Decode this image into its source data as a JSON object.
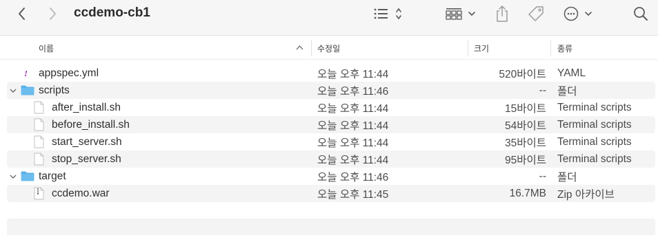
{
  "window": {
    "title": "ccdemo-cb1"
  },
  "toolbar": {
    "icons": [
      "chevron-left-icon",
      "chevron-right-icon",
      "list-view-icon",
      "group-grid-icon",
      "share-icon",
      "tag-icon",
      "more-icon",
      "search-icon"
    ]
  },
  "columns": {
    "name": "이름",
    "modified": "수정일",
    "size": "크기",
    "kind": "종류"
  },
  "files": [
    {
      "name": "appspec.yml",
      "modified": "오늘 오후 11:44",
      "size": "520바이트",
      "kind": "YAML",
      "icon": "yaml-file-icon"
    },
    {
      "name": "scripts",
      "modified": "오늘 오후 11:46",
      "size": "--",
      "kind": "폴더",
      "icon": "folder-icon",
      "expanded": true
    },
    {
      "name": "after_install.sh",
      "modified": "오늘 오후 11:44",
      "size": "15바이트",
      "kind": "Terminal scripts",
      "icon": "document-icon"
    },
    {
      "name": "before_install.sh",
      "modified": "오늘 오후 11:44",
      "size": "54바이트",
      "kind": "Terminal scripts",
      "icon": "document-icon"
    },
    {
      "name": "start_server.sh",
      "modified": "오늘 오후 11:44",
      "size": "35바이트",
      "kind": "Terminal scripts",
      "icon": "document-icon"
    },
    {
      "name": "stop_server.sh",
      "modified": "오늘 오후 11:44",
      "size": "95바이트",
      "kind": "Terminal scripts",
      "icon": "document-icon"
    },
    {
      "name": "target",
      "modified": "오늘 오후 11:46",
      "size": "--",
      "kind": "폴더",
      "icon": "folder-icon",
      "expanded": true
    },
    {
      "name": "ccdemo.war",
      "modified": "오늘 오후 11:45",
      "size": "16.7MB",
      "kind": "Zip 아카이브",
      "icon": "archive-file-icon"
    }
  ],
  "colors": {
    "folder": "#5ab0e8",
    "toolbar_bg": "#f6f6f6",
    "stripe": "#f4f4f4"
  }
}
